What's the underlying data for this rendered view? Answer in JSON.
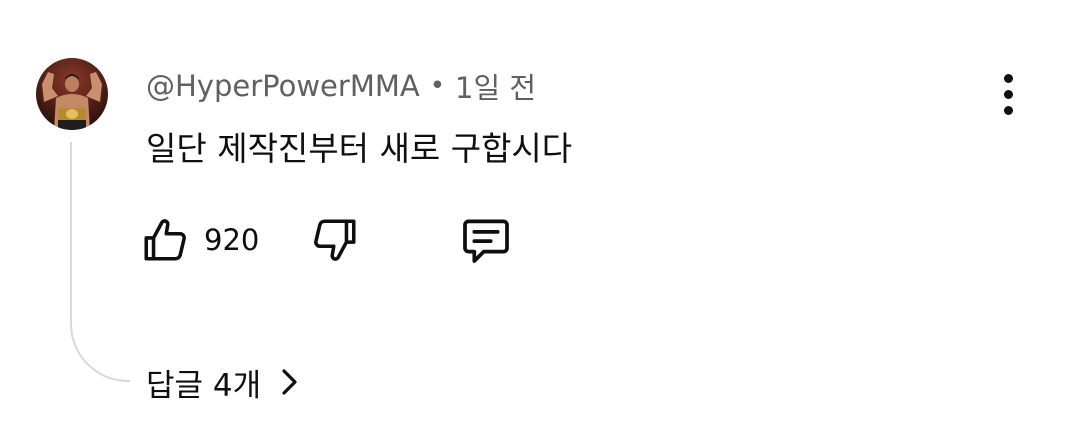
{
  "comment": {
    "author": "@HyperPowerMMA",
    "separator": "•",
    "timestamp": "1일 전",
    "text": "일단 제작진부터 새로 구합시다",
    "like_count": "920",
    "replies_label": "답글 4개"
  },
  "icons": {
    "like": "thumbs-up-icon",
    "dislike": "thumbs-down-icon",
    "reply": "comment-icon",
    "more": "more-vertical-icon",
    "expand": "chevron-right-icon"
  },
  "colors": {
    "text_primary": "#0f0f0f",
    "text_secondary": "#606060",
    "thread_line": "#d9d9d9",
    "background": "#ffffff"
  }
}
